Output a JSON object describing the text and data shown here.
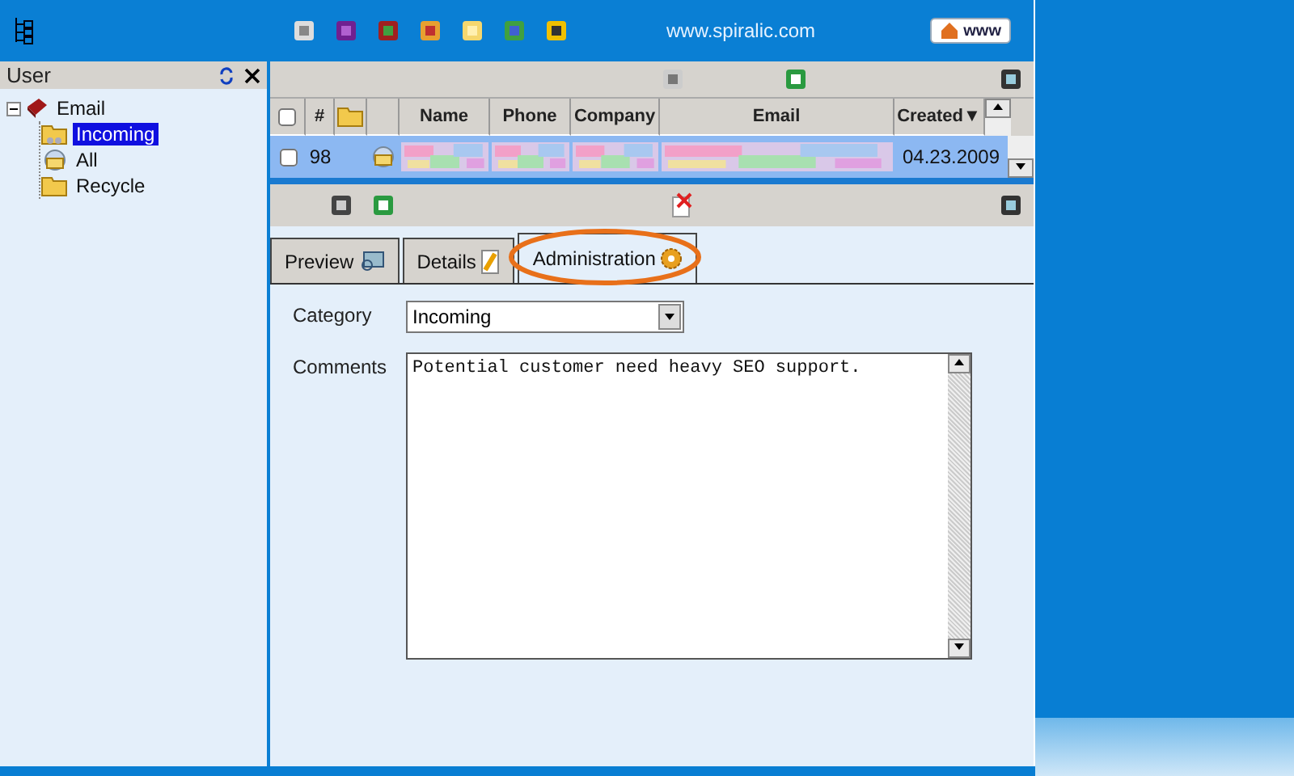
{
  "header": {
    "url": "www.spiralic.com",
    "www_button": "www"
  },
  "sidebar": {
    "title": "User",
    "tree": [
      {
        "label": "Email",
        "expanded": true,
        "selected": false,
        "children": [
          {
            "label": "Incoming",
            "selected": true
          },
          {
            "label": "All",
            "selected": false
          },
          {
            "label": "Recycle",
            "selected": false
          }
        ]
      }
    ]
  },
  "grid": {
    "select_all_checked": false,
    "columns": [
      {
        "kind": "checkbox"
      },
      {
        "kind": "text",
        "label": "#"
      },
      {
        "kind": "folder"
      },
      {
        "kind": "blank"
      },
      {
        "kind": "text",
        "label": "Name"
      },
      {
        "kind": "text",
        "label": "Phone"
      },
      {
        "kind": "text",
        "label": "Company"
      },
      {
        "kind": "text",
        "label": "Email"
      },
      {
        "kind": "text",
        "label": "Created▼"
      }
    ],
    "rows": [
      {
        "checked": false,
        "selected": true,
        "number": "98",
        "created": "04.23.2009"
      }
    ]
  },
  "tabs": [
    {
      "label": "Preview",
      "selected": false
    },
    {
      "label": "Details",
      "selected": false
    },
    {
      "label": "Administration",
      "selected": true
    }
  ],
  "form": {
    "category_label": "Category",
    "category": "Incoming",
    "comments_label": "Comments",
    "comments": "Potential customer need heavy SEO support."
  }
}
